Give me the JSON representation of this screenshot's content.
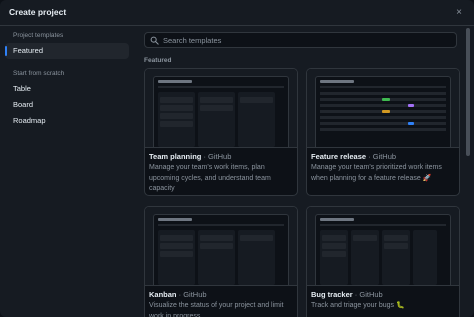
{
  "dialog": {
    "title": "Create project",
    "close_label": "×"
  },
  "sidebar": {
    "project_templates_label": "Project templates",
    "templates": [
      {
        "label": "Featured",
        "active": true
      }
    ],
    "scratch_label": "Start from scratch",
    "scratch_items": [
      {
        "label": "Table"
      },
      {
        "label": "Board"
      },
      {
        "label": "Roadmap"
      }
    ]
  },
  "search": {
    "placeholder": "Search templates",
    "value": ""
  },
  "featured": {
    "section_label": "Featured",
    "separator": " · ",
    "cards": [
      {
        "name": "Team planning",
        "owner": "GitHub",
        "description": "Manage your team's work items, plan upcoming cycles, and understand team capacity",
        "preview": "board"
      },
      {
        "name": "Feature release",
        "owner": "GitHub",
        "description": "Manage your team's prioritized work items when planning for a feature release 🚀",
        "preview": "table"
      },
      {
        "name": "Kanban",
        "owner": "GitHub",
        "description": "Visualize the status of your project and limit work in progress",
        "preview": "board"
      },
      {
        "name": "Bug tracker",
        "owner": "GitHub",
        "description": "Track and triage your bugs 🐛",
        "preview": "table"
      }
    ]
  },
  "colors": {
    "accent": "#2f81f7",
    "background": "#161b22",
    "border": "#30363d",
    "muted_text": "#8b949e"
  }
}
